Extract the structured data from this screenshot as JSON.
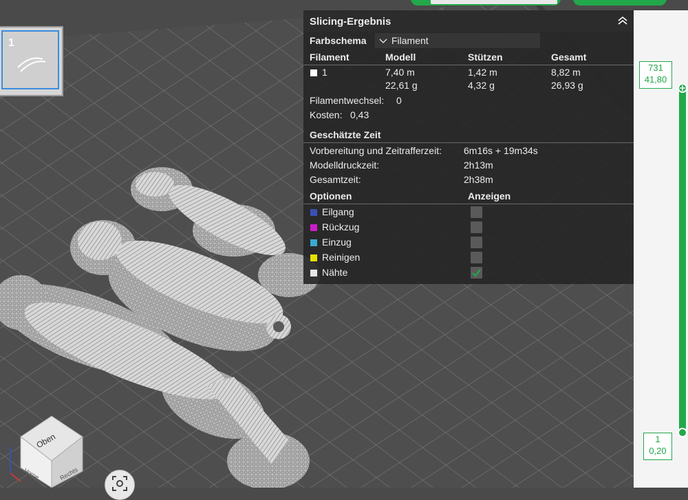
{
  "plate": {
    "number": "1"
  },
  "result_panel": {
    "title": "Slicing-Ergebnis",
    "color_scheme_label": "Farbschema",
    "color_scheme_value": "Filament",
    "table": {
      "headers": [
        "Filament",
        "Modell",
        "Stützen",
        "Gesamt"
      ],
      "rows": [
        {
          "filament": "1",
          "model_length": "7,40 m",
          "model_weight": "22,61 g",
          "support_length": "1,42 m",
          "support_weight": "4,32 g",
          "total_length": "8,82 m",
          "total_weight": "26,93 g"
        }
      ]
    },
    "filament_changes_label": "Filamentwechsel:",
    "filament_changes_value": "0",
    "cost_label": "Kosten:",
    "cost_value": "0,43",
    "time_section_title": "Geschätzte Zeit",
    "prep_time_label": "Vorbereitung und Zeitrafferzeit:",
    "prep_time_value": "6m16s + 19m34s",
    "model_time_label": "Modelldruckzeit:",
    "model_time_value": "2h13m",
    "total_time_label": "Gesamtzeit:",
    "total_time_value": "2h38m",
    "options_header": "Optionen",
    "display_header": "Anzeigen",
    "options": [
      {
        "label": "Eilgang",
        "color": "#3a4fb5",
        "checked": false
      },
      {
        "label": "Rückzug",
        "color": "#c81ec8",
        "checked": false
      },
      {
        "label": "Einzug",
        "color": "#3aa8d0",
        "checked": false
      },
      {
        "label": "Reinigen",
        "color": "#e8e000",
        "checked": false
      },
      {
        "label": "Nähte",
        "color": "#e8e8e8",
        "checked": true
      }
    ]
  },
  "layer_slider": {
    "top_layer": "731",
    "top_height": "41,80",
    "bottom_layer": "1",
    "bottom_height": "0,20",
    "accent": "#22a84a"
  },
  "view_cube": {
    "top_face": "Oben",
    "front_face": "Vorne",
    "right_face": "Rechts"
  }
}
